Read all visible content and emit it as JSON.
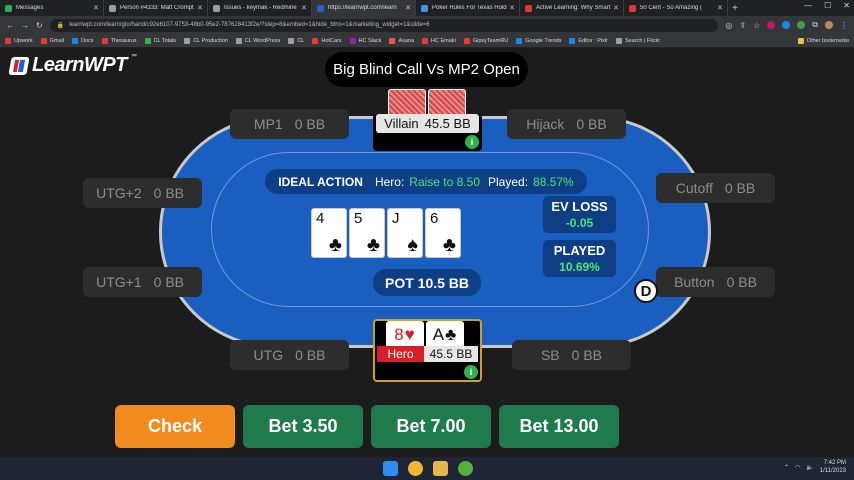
{
  "browser": {
    "tabs": [
      {
        "label": "Messages",
        "color": "#2fb24a",
        "active": false
      },
      {
        "label": "Person #4333: Matt Crompt",
        "color": "#9e9e9e",
        "active": false
      },
      {
        "label": "Issues - keymak - Redmine",
        "color": "#9e9e9e",
        "active": false
      },
      {
        "label": "https://learnwpt.com/learn",
        "color": "#1e63c9",
        "active": true
      },
      {
        "label": "Poker Rules For Texas Hold'",
        "color": "#4a90e2",
        "active": false
      },
      {
        "label": "Active Learning: Why Smart",
        "color": "#e53935",
        "active": false
      },
      {
        "label": "50 Cent - So Amazing (",
        "color": "#e53935",
        "active": false
      }
    ],
    "new_tab_glyph": "+",
    "url": "learnwpt.com/learn/gto/hand/c92e6107-9753-48b0-95e2-787628413f2e/?step=8&embed=1&hide_btns=1&marketing_widget=1&slide=6",
    "bookmarks": [
      {
        "label": "Upwork",
        "color": "#e53935"
      },
      {
        "label": "Gmail",
        "color": "#e53935"
      },
      {
        "label": "Docs",
        "color": "#1e88e5"
      },
      {
        "label": "Thesaurus",
        "color": "#e53935"
      },
      {
        "label": "CL Totals",
        "color": "#2fb24a"
      },
      {
        "label": "CL Production",
        "color": "#9e9e9e"
      },
      {
        "label": "CL WordPress",
        "color": "#9e9e9e"
      },
      {
        "label": "CL",
        "color": "#9e9e9e"
      },
      {
        "label": "HotCars",
        "color": "#e53935"
      },
      {
        "label": "HC Slack",
        "color": "#8e24aa"
      },
      {
        "label": "Asana",
        "color": "#ef5350"
      },
      {
        "label": "HC Emaki",
        "color": "#e53935"
      },
      {
        "label": "GipsyTeamRU",
        "color": "#e53935"
      },
      {
        "label": "Google Trends",
        "color": "#1e88e5"
      },
      {
        "label": "Editor : Pixlr",
        "color": "#1e88e5"
      },
      {
        "label": "Search | Flickr",
        "color": "#9e9e9e"
      }
    ],
    "other_bookmarks": "Other bookmarks"
  },
  "game": {
    "logo": "LearnWPT",
    "logo_tm": "™",
    "spot_title": "Big Blind Call Vs MP2 Open",
    "seats": {
      "mp1": {
        "name": "MP1",
        "stack": "0 BB"
      },
      "hijack": {
        "name": "Hijack",
        "stack": "0 BB"
      },
      "utg2": {
        "name": "UTG+2",
        "stack": "0 BB"
      },
      "cutoff": {
        "name": "Cutoff",
        "stack": "0 BB"
      },
      "utg1": {
        "name": "UTG+1",
        "stack": "0 BB"
      },
      "button": {
        "name": "Button",
        "stack": "0 BB"
      },
      "utg": {
        "name": "UTG",
        "stack": "0 BB"
      },
      "sb": {
        "name": "SB",
        "stack": "0 BB"
      }
    },
    "villain": {
      "name": "Villain",
      "stack": "45.5 BB"
    },
    "hero": {
      "name": "Hero",
      "stack": "45.5 BB",
      "card1": "8♥",
      "card2": "A♣"
    },
    "info_glyph": "i",
    "ideal": {
      "label": "IDEAL ACTION",
      "hero_prefix": "Hero:",
      "hero_action": "Raise to 8.50",
      "played_prefix": "Played:",
      "played_value": "88.57%"
    },
    "board": [
      {
        "rank": "4",
        "suit": "♣"
      },
      {
        "rank": "5",
        "suit": "♣"
      },
      {
        "rank": "J",
        "suit": "♠"
      },
      {
        "rank": "6",
        "suit": "♣"
      }
    ],
    "pot": "POT 10.5 BB",
    "ev_loss": {
      "title": "EV LOSS",
      "value": "-0.05"
    },
    "played": {
      "title": "PLAYED",
      "value": "10.69%"
    },
    "dealer": "D",
    "actions": {
      "check": "Check",
      "bet1": "Bet 3.50",
      "bet2": "Bet 7.00",
      "bet3": "Bet 13.00"
    },
    "colors": {
      "felt": "#1a5fbf",
      "panel": "#0e3f85",
      "check": "#f28c1e",
      "bet": "#1f7a4d",
      "hero_tag": "#d61f26",
      "accent_green": "#4ee37a"
    }
  },
  "taskbar": {
    "time": "7:42 PM",
    "date": "1/11/2023"
  }
}
